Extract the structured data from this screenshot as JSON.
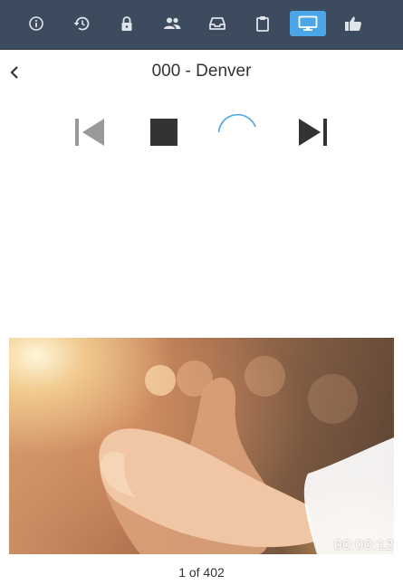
{
  "toolbar": {
    "items": [
      {
        "icon": "info-icon",
        "active": false
      },
      {
        "icon": "history-icon",
        "active": false
      },
      {
        "icon": "lock-icon",
        "active": false
      },
      {
        "icon": "people-icon",
        "active": false
      },
      {
        "icon": "inbox-icon",
        "active": false
      },
      {
        "icon": "clipboard-icon",
        "active": false
      },
      {
        "icon": "monitor-icon",
        "active": true
      },
      {
        "icon": "thumbs-up-icon",
        "active": false
      }
    ],
    "active_color": "#4aa6e6",
    "background_color": "#3d4b5e"
  },
  "header": {
    "title": "000 - Denver",
    "back_icon": "chevron-left-icon"
  },
  "controls": {
    "icons": [
      "skip-previous-icon",
      "stop-icon",
      "loading-spinner",
      "skip-next-icon"
    ]
  },
  "video": {
    "timestamp": "00:00:12"
  },
  "pager": {
    "text": "1 of 402"
  }
}
